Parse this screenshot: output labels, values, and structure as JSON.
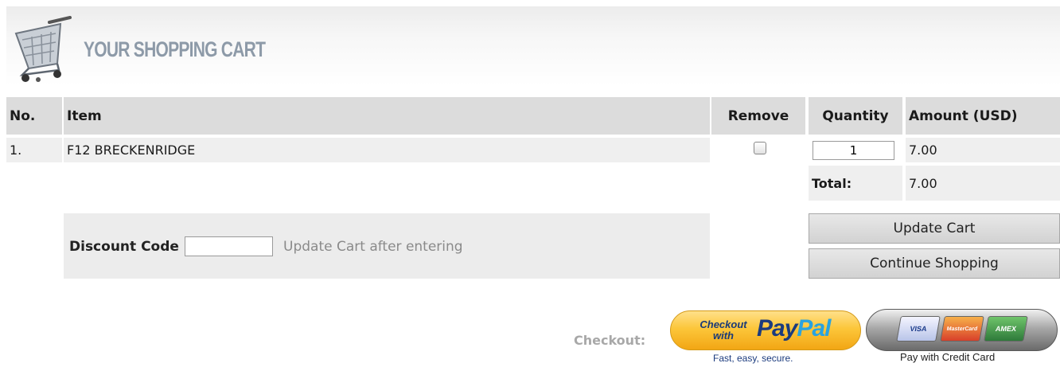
{
  "header": {
    "title": "YOUR SHOPPING CART",
    "icon": "shopping-cart-icon"
  },
  "cart_table": {
    "columns": [
      "No.",
      "Item",
      "Remove",
      "Quantity",
      "Amount (USD)"
    ],
    "rows": [
      {
        "no": "1.",
        "item": "F12 BRECKENRIDGE",
        "remove_checked": false,
        "quantity": "1",
        "amount": "7.00"
      }
    ],
    "total_label": "Total:",
    "total_value": "7.00"
  },
  "discount": {
    "label": "Discount Code",
    "value": "",
    "hint": "Update Cart after entering"
  },
  "buttons": {
    "update_cart": "Update Cart",
    "continue_shopping": "Continue Shopping"
  },
  "checkout": {
    "label": "Checkout:",
    "paypal_line1": "Checkout",
    "paypal_line2": "with",
    "paypal_pay": "Pay",
    "paypal_pal": "Pal",
    "paypal_tagline": "Fast, easy, secure.",
    "credit_card_caption": "Pay with Credit Card",
    "card_visa": "VISA",
    "card_mastercard": "MasterCard",
    "card_amex": "AMEX"
  },
  "colors": {
    "header_bg": "#ececec",
    "table_header_bg": "#dcdcdc",
    "row_bg": "#efefef",
    "title_color": "#8d9aa8",
    "paypal_gold": "#fcc63a",
    "paypal_navy": "#1b3b7e",
    "paypal_light_blue": "#2aa3e0"
  }
}
